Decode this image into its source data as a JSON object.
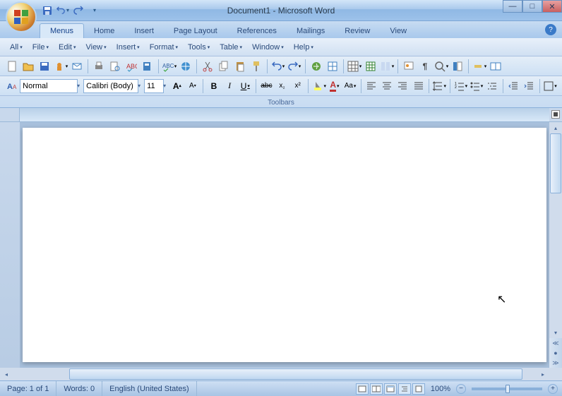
{
  "title": "Document1 - Microsoft Word",
  "ribbon_tabs": [
    "Menus",
    "Home",
    "Insert",
    "Page Layout",
    "References",
    "Mailings",
    "Review",
    "View"
  ],
  "active_tab_index": 0,
  "menus": [
    "All",
    "File",
    "Edit",
    "View",
    "Insert",
    "Format",
    "Tools",
    "Table",
    "Window",
    "Help"
  ],
  "formatting": {
    "style": "Normal",
    "font": "Calibri (Body)",
    "size": "11"
  },
  "toolbars_label": "Toolbars",
  "status": {
    "page": "Page: 1 of 1",
    "words": "Words: 0",
    "language": "English (United States)",
    "zoom": "100%"
  },
  "qat": {
    "save": "save-icon",
    "undo": "undo-icon",
    "redo": "redo-icon"
  }
}
